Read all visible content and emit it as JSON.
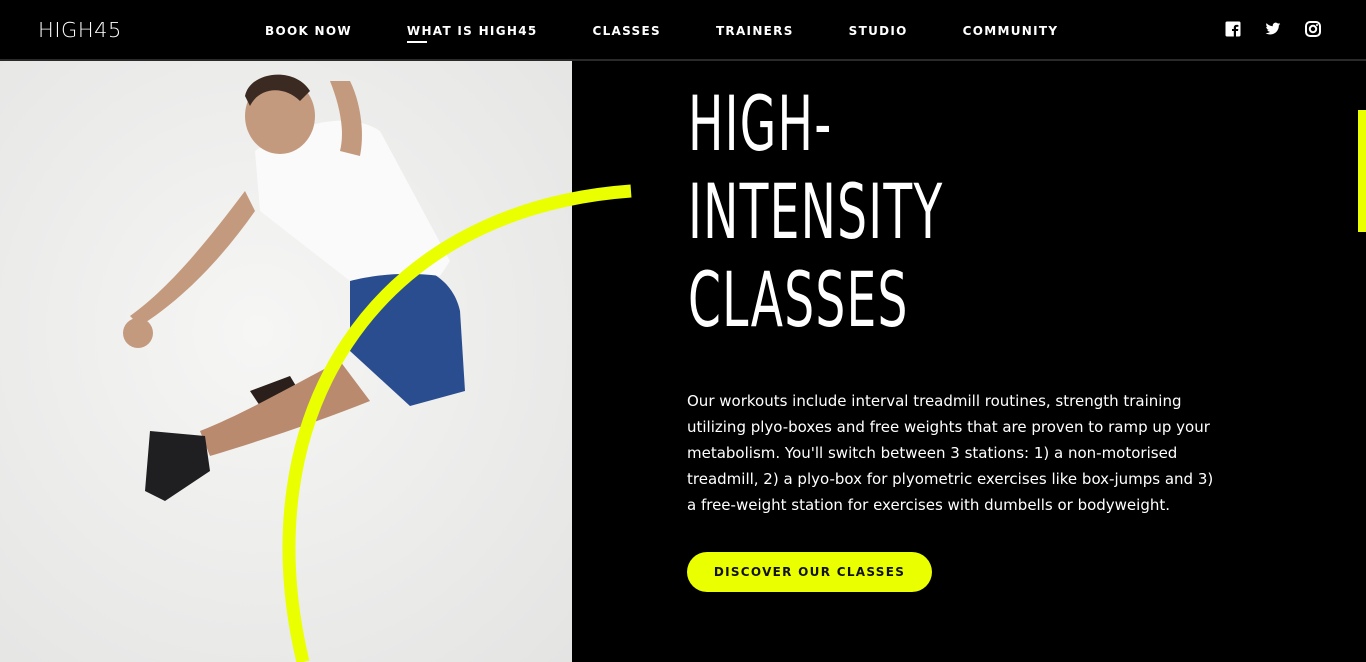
{
  "nav": {
    "logo": "HIGH45",
    "links": [
      {
        "label": "BOOK NOW"
      },
      {
        "label": "WHAT IS HIGH45",
        "active": true
      },
      {
        "label": "CLASSES"
      },
      {
        "label": "TRAINERS"
      },
      {
        "label": "STUDIO"
      },
      {
        "label": "COMMUNITY"
      }
    ],
    "social": [
      "facebook-icon",
      "twitter-icon",
      "instagram-icon"
    ]
  },
  "hero": {
    "image": "athlete-jumping-photo",
    "headline": [
      "HIGH-",
      "INTENSITY",
      "CLASSES"
    ],
    "description": "Our workouts include interval treadmill routines, strength training utilizing plyo-boxes and free weights that are proven to ramp up your metabolism. You'll switch between 3 stations: 1) a non-motorised treadmill, 2) a plyo-box for plyometric exercises like box-jumps and 3) a free-weight station for exercises with dumbells or bodyweight.",
    "cta": "DISCOVER OUR CLASSES"
  },
  "colors": {
    "accent": "#eaff00",
    "background": "#000000",
    "text": "#ffffff"
  }
}
